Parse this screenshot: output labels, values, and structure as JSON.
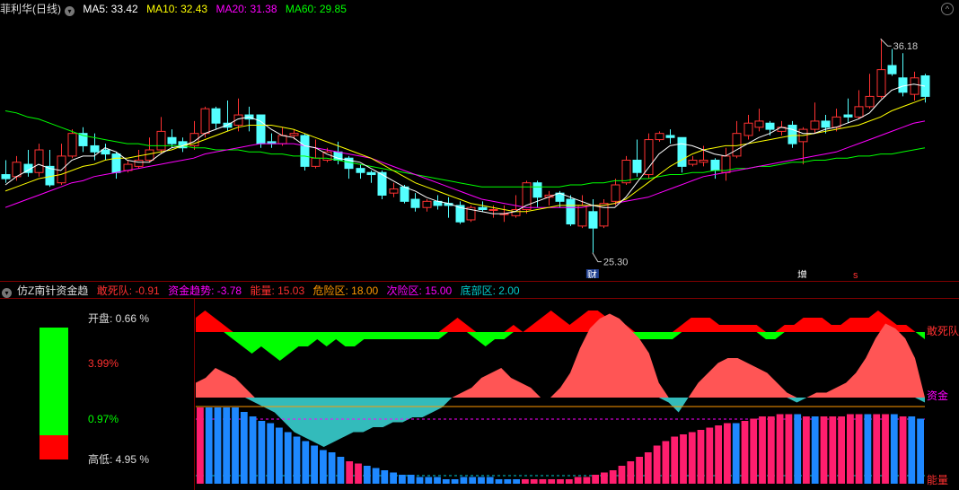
{
  "header": {
    "stock_name": "菲利华(日线)",
    "ma_items": [
      {
        "label": "MA5: 33.42",
        "color": "#ffffff"
      },
      {
        "label": "MA10: 32.43",
        "color": "#ffff00"
      },
      {
        "label": "MA20: 31.38",
        "color": "#ff00ff"
      },
      {
        "label": "MA60: 29.85",
        "color": "#00ff00"
      }
    ]
  },
  "price_annotations": {
    "high_label": "36.18",
    "low_label": "25.30",
    "cai_label": "财",
    "zeng_label": "增",
    "s_label": "s"
  },
  "indicator_header": {
    "name": "仿Z南针资金趋",
    "items": [
      {
        "label": "敢死队: -0.91",
        "color": "#ff3030"
      },
      {
        "label": "资金趋势: -3.78",
        "color": "#ff00ff"
      },
      {
        "label": "能量: 15.03",
        "color": "#ff3030"
      },
      {
        "label": "危险区: 18.00",
        "color": "#ff9900"
      },
      {
        "label": "次险区: 15.00",
        "color": "#ff00ff"
      },
      {
        "label": "底部区: 2.00",
        "color": "#00cccc"
      }
    ]
  },
  "side_panel": {
    "open_label": "开盘: 0.66 %",
    "pct_top": "3.99%",
    "pct_mid": "0.97%",
    "range_label": "高低: 4.95 %"
  },
  "right_labels": {
    "gansi": "敢死队",
    "zijin": "资金",
    "nengliang": "能量"
  },
  "colors": {
    "up": "#ff3232",
    "down": "#54ffff",
    "ma5": "#ffffff",
    "ma10": "#ffff00",
    "ma20": "#ff00ff",
    "ma60": "#00ff00",
    "gansi_pos": "#ff0000",
    "gansi_neg": "#00ff00",
    "zijin_pos": "#ff5555",
    "zijin_neg": "#33bbbb",
    "bar_pink": "#ff1e6e",
    "bar_blue": "#1e88ff"
  },
  "chart_data": {
    "type": "candlestick",
    "y_range": [
      24.5,
      36.8
    ],
    "candles": [
      [
        29.1,
        28.9,
        29.8,
        28.7
      ],
      [
        29.0,
        29.7,
        30.0,
        28.8
      ],
      [
        29.6,
        29.2,
        30.3,
        29.0
      ],
      [
        29.2,
        30.3,
        30.6,
        29.0
      ],
      [
        29.5,
        28.6,
        30.3,
        28.5
      ],
      [
        28.7,
        30.0,
        30.6,
        28.6
      ],
      [
        30.0,
        31.1,
        31.3,
        29.9
      ],
      [
        31.1,
        30.5,
        31.4,
        30.2
      ],
      [
        30.5,
        30.2,
        31.1,
        29.8
      ],
      [
        30.3,
        30.1,
        30.6,
        29.8
      ],
      [
        30.1,
        29.2,
        30.2,
        28.9
      ],
      [
        29.3,
        29.6,
        29.8,
        29.2
      ],
      [
        29.5,
        29.8,
        30.3,
        29.4
      ],
      [
        29.8,
        30.3,
        30.9,
        29.7
      ],
      [
        30.3,
        31.2,
        31.9,
        30.1
      ],
      [
        30.9,
        30.6,
        31.3,
        30.4
      ],
      [
        30.7,
        30.4,
        30.9,
        30.2
      ],
      [
        30.5,
        31.1,
        31.7,
        30.3
      ],
      [
        31.1,
        32.3,
        32.4,
        30.9
      ],
      [
        32.3,
        31.6,
        32.4,
        31.3
      ],
      [
        31.6,
        31.4,
        32.7,
        31.2
      ],
      [
        31.5,
        32.0,
        32.8,
        31.2
      ],
      [
        32.0,
        31.8,
        32.4,
        31.2
      ],
      [
        32.0,
        30.6,
        32.0,
        30.4
      ],
      [
        30.7,
        30.6,
        31.1,
        30.4
      ],
      [
        30.6,
        31.0,
        31.4,
        30.5
      ],
      [
        31.0,
        31.1,
        31.3,
        30.8
      ],
      [
        31.0,
        29.5,
        31.1,
        29.3
      ],
      [
        29.5,
        29.9,
        30.8,
        29.4
      ],
      [
        29.8,
        30.2,
        30.4,
        29.7
      ],
      [
        30.2,
        29.8,
        30.7,
        29.6
      ],
      [
        29.9,
        29.4,
        30.0,
        28.9
      ],
      [
        29.4,
        29.2,
        29.6,
        28.9
      ],
      [
        29.2,
        29.1,
        29.3,
        28.7
      ],
      [
        29.2,
        28.1,
        29.3,
        27.9
      ],
      [
        28.2,
        28.4,
        28.7,
        28.0
      ],
      [
        28.5,
        27.8,
        28.6,
        27.7
      ],
      [
        27.9,
        27.5,
        28.2,
        27.3
      ],
      [
        27.5,
        27.8,
        27.9,
        27.3
      ],
      [
        27.8,
        27.6,
        28.1,
        27.4
      ],
      [
        27.7,
        27.6,
        28.0,
        27.0
      ],
      [
        27.6,
        26.8,
        27.8,
        26.7
      ],
      [
        26.9,
        27.5,
        27.6,
        26.8
      ],
      [
        27.5,
        27.4,
        27.8,
        27.3
      ],
      [
        27.4,
        27.4,
        27.6,
        27.0
      ],
      [
        27.2,
        27.2,
        27.6,
        26.8
      ],
      [
        27.1,
        27.4,
        28.1,
        27.0
      ],
      [
        27.4,
        28.7,
        28.8,
        27.2
      ],
      [
        28.7,
        28.0,
        28.8,
        27.5
      ],
      [
        28.0,
        28.1,
        28.3,
        27.6
      ],
      [
        28.2,
        27.8,
        28.3,
        27.5
      ],
      [
        27.9,
        26.7,
        28.1,
        26.6
      ],
      [
        26.6,
        27.6,
        28.1,
        26.5
      ],
      [
        27.3,
        26.5,
        27.9,
        25.3
      ],
      [
        26.6,
        27.7,
        27.9,
        26.5
      ],
      [
        27.8,
        28.6,
        28.9,
        27.6
      ],
      [
        28.7,
        29.8,
        30.0,
        28.6
      ],
      [
        29.8,
        29.2,
        30.8,
        29.0
      ],
      [
        29.1,
        30.8,
        31.1,
        28.9
      ],
      [
        30.8,
        31.1,
        31.2,
        30.7
      ],
      [
        31.0,
        30.9,
        31.3,
        30.6
      ],
      [
        30.9,
        29.5,
        30.9,
        29.2
      ],
      [
        29.6,
        29.8,
        30.0,
        29.5
      ],
      [
        29.7,
        29.8,
        30.5,
        29.5
      ],
      [
        29.8,
        29.3,
        29.9,
        28.9
      ],
      [
        29.2,
        30.0,
        30.4,
        28.8
      ],
      [
        30.0,
        31.1,
        31.7,
        29.9
      ],
      [
        31.0,
        31.6,
        32.0,
        30.8
      ],
      [
        31.4,
        31.7,
        32.3,
        31.2
      ],
      [
        31.6,
        31.3,
        31.7,
        31.0
      ],
      [
        31.2,
        31.4,
        31.7,
        31.0
      ],
      [
        31.5,
        30.6,
        31.7,
        30.4
      ],
      [
        30.7,
        31.3,
        31.4,
        29.6
      ],
      [
        31.3,
        31.7,
        32.6,
        31.1
      ],
      [
        31.7,
        31.4,
        32.0,
        31.1
      ],
      [
        31.4,
        31.9,
        32.3,
        31.2
      ],
      [
        32.0,
        31.9,
        32.8,
        31.6
      ],
      [
        31.9,
        32.4,
        33.2,
        31.8
      ],
      [
        32.4,
        32.9,
        34.0,
        32.3
      ],
      [
        32.9,
        34.2,
        35.7,
        32.8
      ],
      [
        34.4,
        34.0,
        35.2,
        33.9
      ],
      [
        33.8,
        33.1,
        35.0,
        32.9
      ],
      [
        33.0,
        33.8,
        34.1,
        32.7
      ],
      [
        33.9,
        32.9,
        34.0,
        32.6
      ]
    ],
    "ma5": [
      28.6,
      29.0,
      29.3,
      29.6,
      29.4,
      29.3,
      29.8,
      30.0,
      30.0,
      30.4,
      30.2,
      29.8,
      29.7,
      29.7,
      30.1,
      30.4,
      30.5,
      30.7,
      31.1,
      31.3,
      31.5,
      31.8,
      31.9,
      31.7,
      31.3,
      31.0,
      30.9,
      30.5,
      30.4,
      30.1,
      29.9,
      29.8,
      29.7,
      29.4,
      29.1,
      28.8,
      28.5,
      28.3,
      28.0,
      27.8,
      27.7,
      27.5,
      27.4,
      27.3,
      27.2,
      27.2,
      27.3,
      27.6,
      27.8,
      28.0,
      28.2,
      28.0,
      27.8,
      27.6,
      27.5,
      27.5,
      28.0,
      28.7,
      29.4,
      30.1,
      30.5,
      30.6,
      30.5,
      30.3,
      30.1,
      30.0,
      30.3,
      30.6,
      30.9,
      31.1,
      31.4,
      31.3,
      31.1,
      31.1,
      31.3,
      31.4,
      31.6,
      31.8,
      32.1,
      32.7,
      33.2,
      33.4,
      33.5,
      33.4
    ],
    "ma10": [
      28.3,
      28.5,
      28.7,
      28.9,
      29.0,
      29.1,
      29.3,
      29.5,
      29.6,
      29.8,
      29.9,
      29.9,
      30.0,
      30.1,
      30.2,
      30.3,
      30.5,
      30.6,
      30.8,
      31.0,
      31.2,
      31.4,
      31.5,
      31.5,
      31.5,
      31.4,
      31.3,
      31.1,
      30.9,
      30.7,
      30.5,
      30.3,
      30.1,
      29.9,
      29.6,
      29.3,
      29.0,
      28.7,
      28.5,
      28.3,
      28.1,
      27.9,
      27.7,
      27.6,
      27.5,
      27.4,
      27.3,
      27.3,
      27.4,
      27.5,
      27.6,
      27.6,
      27.6,
      27.6,
      27.6,
      27.7,
      27.9,
      28.3,
      28.7,
      29.1,
      29.5,
      29.8,
      30.1,
      30.3,
      30.4,
      30.5,
      30.5,
      30.6,
      30.7,
      30.8,
      30.9,
      31.0,
      31.0,
      31.1,
      31.2,
      31.3,
      31.4,
      31.5,
      31.7,
      31.9,
      32.2,
      32.4,
      32.6,
      32.8
    ],
    "ma20": [
      27.5,
      27.7,
      27.9,
      28.1,
      28.3,
      28.5,
      28.7,
      28.8,
      29.0,
      29.1,
      29.2,
      29.3,
      29.4,
      29.5,
      29.6,
      29.7,
      29.8,
      29.9,
      30.1,
      30.2,
      30.3,
      30.4,
      30.5,
      30.6,
      30.6,
      30.6,
      30.6,
      30.5,
      30.4,
      30.3,
      30.2,
      30.1,
      30.0,
      29.9,
      29.7,
      29.5,
      29.3,
      29.1,
      28.9,
      28.7,
      28.5,
      28.3,
      28.1,
      27.9,
      27.8,
      27.7,
      27.6,
      27.5,
      27.5,
      27.5,
      27.5,
      27.5,
      27.5,
      27.6,
      27.6,
      27.7,
      27.8,
      27.9,
      28.0,
      28.2,
      28.4,
      28.6,
      28.8,
      29.0,
      29.1,
      29.2,
      29.3,
      29.4,
      29.5,
      29.6,
      29.7,
      29.8,
      29.9,
      30.0,
      30.1,
      30.2,
      30.4,
      30.6,
      30.8,
      31.0,
      31.2,
      31.4,
      31.6,
      31.7
    ],
    "ma60": [
      32.2,
      32.1,
      31.9,
      31.8,
      31.6,
      31.4,
      31.2,
      31.0,
      30.9,
      30.8,
      30.7,
      30.6,
      30.6,
      30.5,
      30.5,
      30.5,
      30.5,
      30.4,
      30.4,
      30.3,
      30.3,
      30.3,
      30.2,
      30.2,
      30.1,
      30.1,
      30.0,
      30.0,
      29.9,
      29.9,
      29.8,
      29.7,
      29.6,
      29.5,
      29.4,
      29.3,
      29.2,
      29.1,
      29.0,
      28.9,
      28.8,
      28.7,
      28.6,
      28.5,
      28.5,
      28.5,
      28.5,
      28.5,
      28.5,
      28.5,
      28.5,
      28.6,
      28.6,
      28.7,
      28.7,
      28.8,
      28.8,
      28.9,
      28.9,
      29.0,
      29.1,
      29.1,
      29.2,
      29.2,
      29.3,
      29.3,
      29.4,
      29.4,
      29.5,
      29.5,
      29.6,
      29.7,
      29.7,
      29.8,
      29.8,
      29.9,
      29.9,
      30.0,
      30.0,
      30.1,
      30.1,
      30.2,
      30.3,
      30.4
    ],
    "gansi": [
      2,
      3,
      2,
      1,
      -1,
      -2,
      -3,
      -2,
      -3,
      -4,
      -3,
      -2,
      -2,
      -1,
      -2,
      -1,
      -2,
      -2,
      -1,
      -1,
      -1,
      -1,
      -1,
      -1,
      -1,
      -1,
      -1,
      1,
      2,
      1,
      -1,
      -2,
      -1,
      -1,
      1,
      0,
      1,
      2,
      3,
      2,
      1,
      2,
      3,
      3,
      2,
      1,
      1,
      -1,
      -1,
      -1,
      -1,
      -1,
      1,
      2,
      2,
      2,
      1,
      1,
      1,
      1,
      1,
      -1,
      -1,
      1,
      1,
      2,
      2,
      2,
      1,
      1,
      2,
      2,
      2,
      3,
      2,
      1,
      1,
      0,
      -1
    ],
    "zijin": [
      3,
      4,
      6,
      5,
      4,
      2,
      -1,
      -2,
      -3,
      -5,
      -7,
      -8,
      -9,
      -10,
      -9,
      -8,
      -7,
      -7,
      -6,
      -6,
      -5,
      -5,
      -4,
      -4,
      -3,
      -2,
      0,
      1,
      2,
      4,
      5,
      6,
      4,
      3,
      2,
      0,
      0,
      2,
      5,
      10,
      14,
      16,
      17,
      16,
      14,
      12,
      9,
      3,
      -1,
      -3,
      0,
      3,
      5,
      7,
      8,
      8,
      7,
      6,
      5,
      3,
      1,
      -1,
      0,
      1,
      1,
      2,
      3,
      5,
      8,
      12,
      15,
      14,
      12,
      8,
      -1
    ],
    "energy": [
      [
        34,
        "p"
      ],
      [
        34,
        "b"
      ],
      [
        34,
        "b"
      ],
      [
        34,
        "b"
      ],
      [
        34,
        "b"
      ],
      [
        32,
        "b"
      ],
      [
        30,
        "b"
      ],
      [
        28,
        "b"
      ],
      [
        27,
        "b"
      ],
      [
        25,
        "b"
      ],
      [
        23,
        "b"
      ],
      [
        21,
        "b"
      ],
      [
        19,
        "b"
      ],
      [
        17,
        "b"
      ],
      [
        15,
        "b"
      ],
      [
        14,
        "b"
      ],
      [
        12,
        "b"
      ],
      [
        10,
        "p"
      ],
      [
        9,
        "p"
      ],
      [
        8,
        "b"
      ],
      [
        7,
        "b"
      ],
      [
        6,
        "b"
      ],
      [
        5,
        "b"
      ],
      [
        4,
        "b"
      ],
      [
        4,
        "b"
      ],
      [
        3,
        "b"
      ],
      [
        3,
        "b"
      ],
      [
        3,
        "b"
      ],
      [
        2,
        "b"
      ],
      [
        2,
        "b"
      ],
      [
        3,
        "b"
      ],
      [
        3,
        "b"
      ],
      [
        3,
        "b"
      ],
      [
        3,
        "b"
      ],
      [
        2,
        "b"
      ],
      [
        2,
        "b"
      ],
      [
        2,
        "b"
      ],
      [
        2,
        "p"
      ],
      [
        2,
        "p"
      ],
      [
        2,
        "p"
      ],
      [
        2,
        "p"
      ],
      [
        2,
        "p"
      ],
      [
        2,
        "p"
      ],
      [
        3,
        "p"
      ],
      [
        3,
        "p"
      ],
      [
        4,
        "p"
      ],
      [
        5,
        "p"
      ],
      [
        6,
        "p"
      ],
      [
        8,
        "p"
      ],
      [
        10,
        "p"
      ],
      [
        12,
        "p"
      ],
      [
        14,
        "p"
      ],
      [
        17,
        "p"
      ],
      [
        19,
        "p"
      ],
      [
        21,
        "p"
      ],
      [
        22,
        "p"
      ],
      [
        23,
        "p"
      ],
      [
        24,
        "p"
      ],
      [
        25,
        "p"
      ],
      [
        26,
        "p"
      ],
      [
        27,
        "p"
      ],
      [
        27,
        "b"
      ],
      [
        28,
        "p"
      ],
      [
        29,
        "p"
      ],
      [
        30,
        "p"
      ],
      [
        30,
        "p"
      ],
      [
        31,
        "p"
      ],
      [
        31,
        "p"
      ],
      [
        31,
        "b"
      ],
      [
        30,
        "p"
      ],
      [
        30,
        "b"
      ],
      [
        30,
        "p"
      ],
      [
        30,
        "p"
      ],
      [
        30,
        "p"
      ],
      [
        31,
        "p"
      ],
      [
        31,
        "p"
      ],
      [
        31,
        "b"
      ],
      [
        31,
        "p"
      ],
      [
        31,
        "p"
      ],
      [
        31,
        "b"
      ],
      [
        30,
        "p"
      ],
      [
        30,
        "b"
      ],
      [
        29,
        "b"
      ]
    ]
  }
}
